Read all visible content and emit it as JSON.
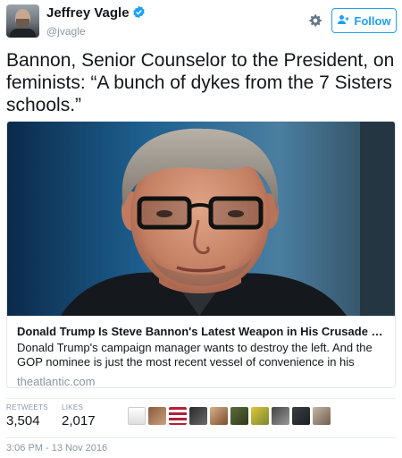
{
  "user": {
    "display_name": "Jeffrey Vagle",
    "handle": "@jvagle",
    "verified": true
  },
  "header": {
    "follow_label": "Follow",
    "settings_icon": "gear-icon",
    "follow_icon": "add-user-icon"
  },
  "tweet": {
    "text": "Bannon, Senior Counselor to the President, on feminists: “A bunch of dykes from the 7 Sisters schools.”"
  },
  "card": {
    "title": "Donald Trump Is Steve Bannon's Latest Weapon in His Crusade to Destroy ...",
    "description": "Donald Trump's campaign manager wants to destroy the left. And the GOP nominee is just the most recent vessel of convenience in his consequences-be-damned cr...",
    "domain": "theatlantic.com"
  },
  "stats": {
    "retweets_label": "RETWEETS",
    "retweets": "3,504",
    "likes_label": "LIKES",
    "likes": "2,017"
  },
  "timestamp": "3:06 PM - 13 Nov 2016",
  "colors": {
    "accent": "#1da1f2",
    "muted": "#8899a6",
    "border": "#e1e8ed"
  }
}
